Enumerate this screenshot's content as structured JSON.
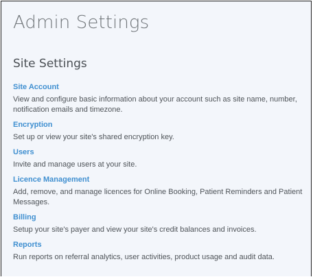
{
  "page": {
    "title": "Admin Settings"
  },
  "section": {
    "title": "Site Settings"
  },
  "settings": [
    {
      "label": "Site Account",
      "description": "View and configure basic information about your account such as site name, number, notification emails and timezone."
    },
    {
      "label": "Encryption",
      "description": "Set up or view your site's shared encryption key."
    },
    {
      "label": "Users",
      "description": "Invite and manage users at your site."
    },
    {
      "label": "Licence Management",
      "description": "Add, remove, and manage licences for Online Booking, Patient Reminders and Patient Messages."
    },
    {
      "label": "Billing",
      "description": "Setup your site's payer and view your site's credit balances and invoices."
    },
    {
      "label": "Reports",
      "description": "Run reports on referral analytics, user activities, product usage and audit data."
    }
  ]
}
